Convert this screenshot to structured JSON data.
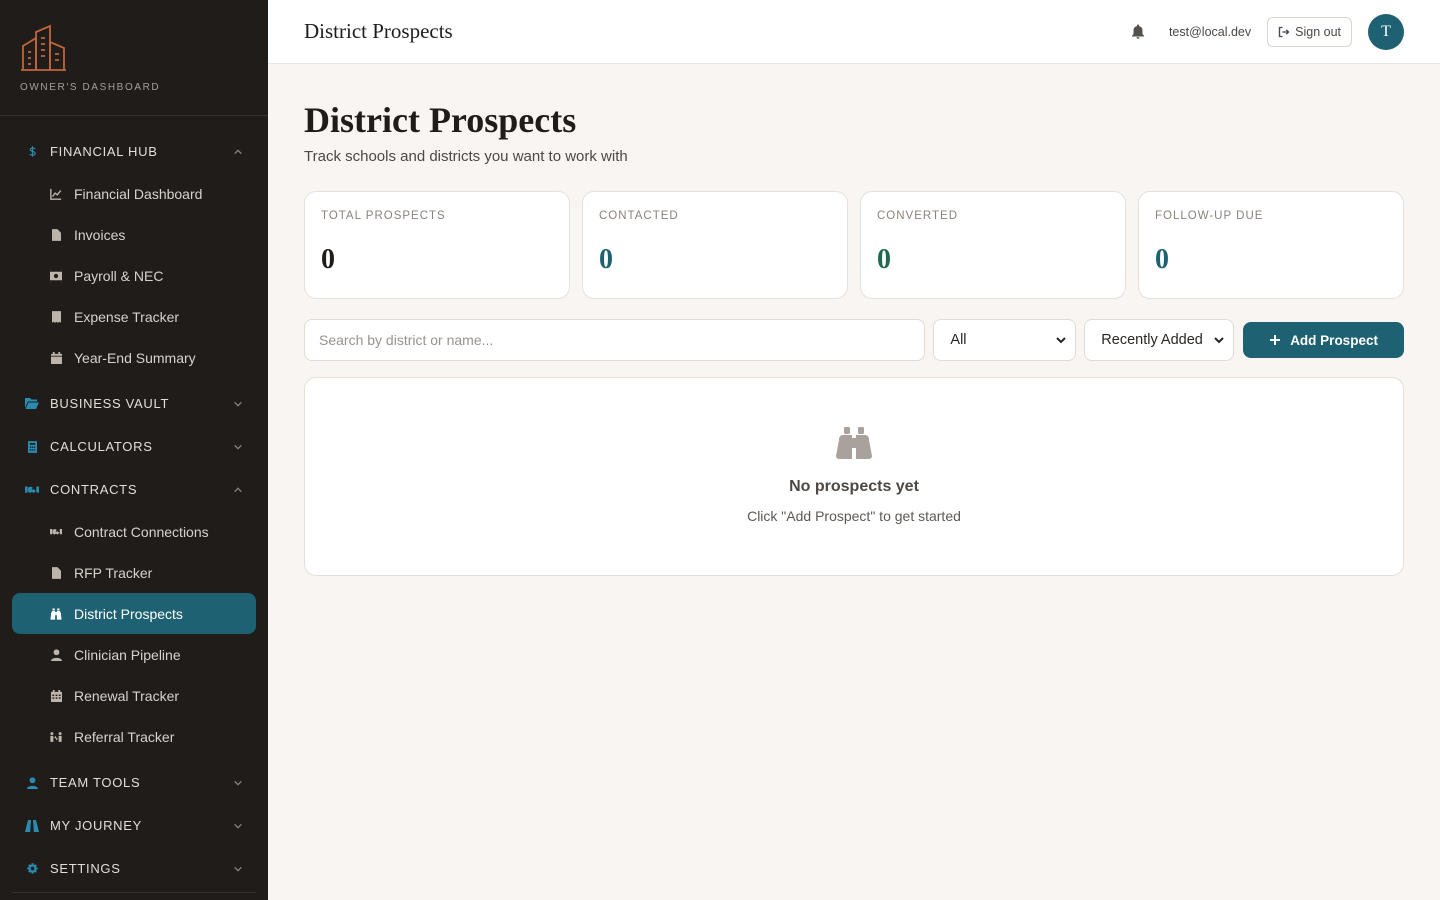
{
  "brand": {
    "label": "OWNER'S DASHBOARD"
  },
  "sidebar": {
    "sections": [
      {
        "label": "FINANCIAL HUB",
        "icon": "dollar-icon",
        "expanded": true,
        "items": [
          {
            "label": "Financial Dashboard",
            "icon": "chart-line-icon"
          },
          {
            "label": "Invoices",
            "icon": "file-icon"
          },
          {
            "label": "Payroll & NEC",
            "icon": "money-bill-icon"
          },
          {
            "label": "Expense Tracker",
            "icon": "receipt-icon"
          },
          {
            "label": "Year-End Summary",
            "icon": "calendar-check-icon"
          }
        ]
      },
      {
        "label": "BUSINESS VAULT",
        "icon": "folder-open-icon",
        "expanded": false,
        "items": []
      },
      {
        "label": "CALCULATORS",
        "icon": "calculator-icon",
        "expanded": false,
        "items": []
      },
      {
        "label": "CONTRACTS",
        "icon": "handshake-icon",
        "expanded": true,
        "items": [
          {
            "label": "Contract Connections",
            "icon": "handshake-icon"
          },
          {
            "label": "RFP Tracker",
            "icon": "file-contract-icon"
          },
          {
            "label": "District Prospects",
            "icon": "binoculars-icon",
            "active": true
          },
          {
            "label": "Clinician Pipeline",
            "icon": "user-icon"
          },
          {
            "label": "Renewal Tracker",
            "icon": "calendar-icon"
          },
          {
            "label": "Referral Tracker",
            "icon": "people-arrows-icon"
          }
        ]
      },
      {
        "label": "TEAM TOOLS",
        "icon": "user-tie-icon",
        "expanded": false,
        "items": []
      },
      {
        "label": "MY JOURNEY",
        "icon": "road-icon",
        "expanded": false,
        "items": []
      },
      {
        "label": "SETTINGS",
        "icon": "gear-icon",
        "expanded": false,
        "items": []
      }
    ]
  },
  "header": {
    "title": "District Prospects",
    "email": "test@local.dev",
    "signout_label": "Sign out",
    "avatar_initial": "T"
  },
  "page": {
    "title": "District Prospects",
    "subtitle": "Track schools and districts you want to work with"
  },
  "stats": [
    {
      "label": "TOTAL PROSPECTS",
      "value": "0",
      "color": "#1f1c1a"
    },
    {
      "label": "CONTACTED",
      "value": "0",
      "color": "#1d6172"
    },
    {
      "label": "CONVERTED",
      "value": "0",
      "color": "#1f6b4f"
    },
    {
      "label": "FOLLOW-UP DUE",
      "value": "0",
      "color": "#1d6172"
    }
  ],
  "controls": {
    "search_placeholder": "Search by district or name...",
    "status_filter": "All",
    "sort": "Recently Added",
    "add_label": "Add Prospect"
  },
  "empty_state": {
    "title": "No prospects yet",
    "text": "Click \"Add Prospect\" to get started"
  },
  "colors": {
    "accent": "#1d6172",
    "sidebar_bg": "#1f1c1a",
    "brand_logo": "#c0653a"
  }
}
